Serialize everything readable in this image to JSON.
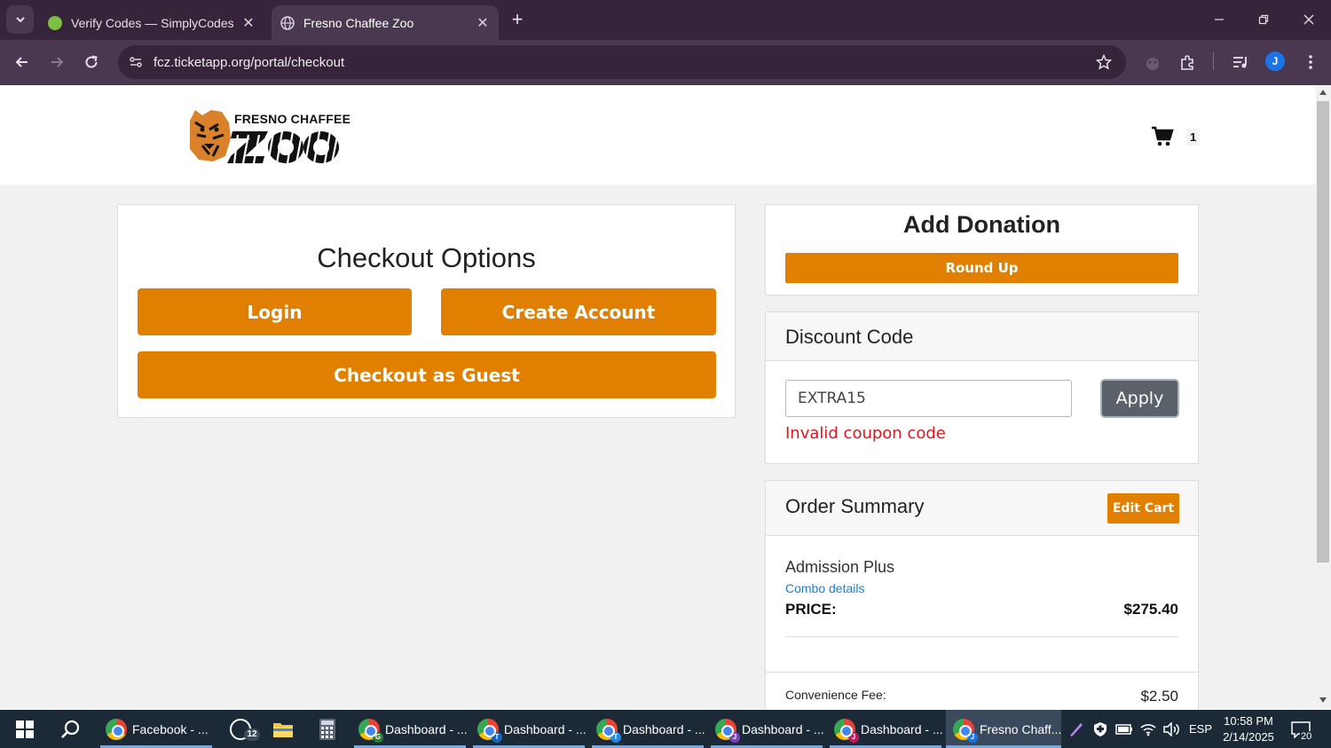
{
  "browser": {
    "tabs": [
      {
        "title": "Verify Codes — SimplyCodes",
        "active": false,
        "favicon": "simplycodes-icon",
        "favicon_color": "#7bc043"
      },
      {
        "title": "Fresno Chaffee Zoo",
        "active": true,
        "favicon": "globe-icon",
        "favicon_color": "#d8d0da"
      }
    ],
    "url": "fcz.ticketapp.org/portal/checkout",
    "profile_initial": "J"
  },
  "site": {
    "logo_text": "FRESNO CHAFFEE",
    "logo_word": "ZOO",
    "cart_count": "1",
    "accent_color": "#e07f00"
  },
  "checkout": {
    "title": "Checkout Options",
    "login_label": "Login",
    "create_account_label": "Create Account",
    "guest_label": "Checkout as Guest"
  },
  "donation": {
    "title": "Add Donation",
    "round_up_label": "Round Up"
  },
  "discount": {
    "title": "Discount Code",
    "input_value": "EXTRA15",
    "apply_label": "Apply",
    "error": "Invalid coupon code",
    "error_color": "#e3141c"
  },
  "summary": {
    "title": "Order Summary",
    "edit_cart_label": "Edit Cart",
    "item_name": "Admission Plus",
    "combo_link": "Combo details",
    "price_label": "PRICE:",
    "price_value": "$275.40",
    "fee_label": "Convenience Fee:",
    "fee_value": "$2.50"
  },
  "taskbar": {
    "apps": [
      {
        "label": "Facebook - ...",
        "icon": "chrome-icon"
      },
      {
        "label": "",
        "icon": "whatsapp-icon",
        "badge": "12"
      },
      {
        "label": "",
        "icon": "file-explorer-icon"
      },
      {
        "label": "",
        "icon": "calculator-icon"
      },
      {
        "label": "Dashboard - ...",
        "icon": "chrome-icon",
        "badge": "G"
      },
      {
        "label": "Dashboard - ...",
        "icon": "chrome-icon",
        "badge": "T"
      },
      {
        "label": "Dashboard - ...",
        "icon": "chrome-icon",
        "badge": "T"
      },
      {
        "label": "Dashboard - ...",
        "icon": "chrome-icon",
        "badge": "J"
      },
      {
        "label": "Dashboard - ...",
        "icon": "chrome-icon",
        "badge": "J"
      },
      {
        "label": "Fresno Chaff...",
        "icon": "chrome-icon",
        "badge": "J"
      }
    ],
    "language": "ESP",
    "time": "10:58 PM",
    "date": "2/14/2025",
    "notification_count": "20"
  }
}
